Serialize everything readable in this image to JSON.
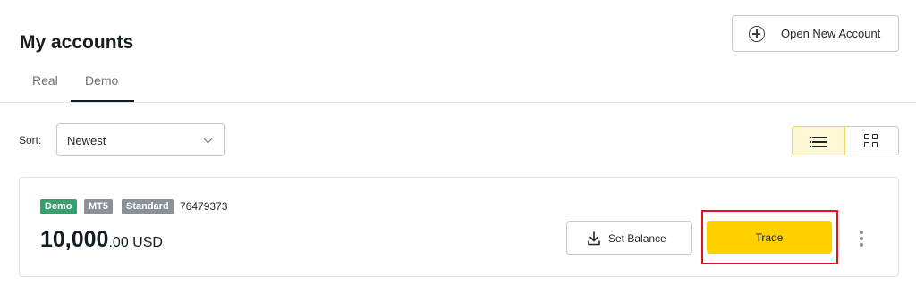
{
  "header": {
    "title": "My accounts",
    "open_account_label": "Open New Account"
  },
  "tabs": [
    {
      "label": "Real",
      "active": false
    },
    {
      "label": "Demo",
      "active": true
    }
  ],
  "sort": {
    "label": "Sort:",
    "selected": "Newest"
  },
  "view_toggle": {
    "active": "list"
  },
  "account": {
    "badges": [
      "Demo",
      "MT5",
      "Standard"
    ],
    "number": "76479373",
    "balance_int": "10,000",
    "balance_dec": ".00",
    "currency": "USD",
    "set_balance_label": "Set Balance",
    "trade_label": "Trade"
  },
  "colors": {
    "accent": "#ffd000",
    "demo_badge": "#3a9f6e",
    "grey_badge": "#8b9196",
    "highlight": "#e0141e"
  }
}
